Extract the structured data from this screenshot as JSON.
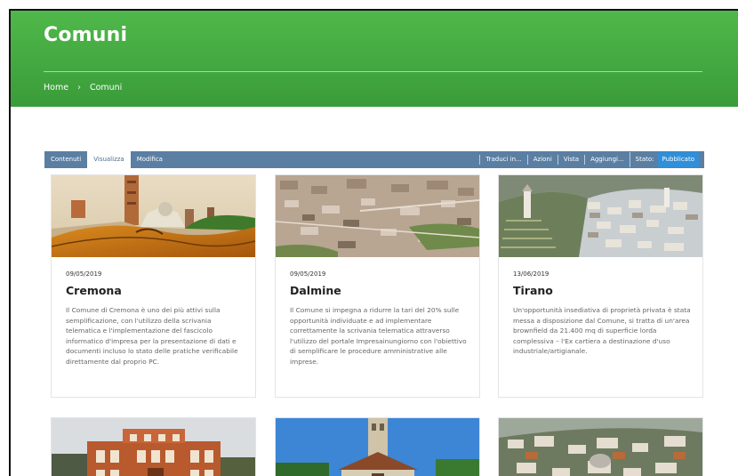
{
  "page": {
    "title": "Comuni",
    "breadcrumb": {
      "home": "Home",
      "separator": "›",
      "current": "Comuni"
    }
  },
  "toolbar": {
    "tabs": [
      "Contenuti",
      "Visualizza",
      "Modifica"
    ],
    "active_tab": "Visualizza",
    "actions": [
      "Traduci in...",
      "Azioni",
      "Vista",
      "Aggiungi..."
    ],
    "stato_label": "Stato:",
    "stato_value": "Pubblicato"
  },
  "cards": [
    {
      "date": "09/05/2019",
      "title": "Cremona",
      "description": "Il Comune di Cremona è uno dei più attivi sulla semplificazione, con l'utilizzo della scrivania telematica e l'implementazione del fascicolo informatico d'impresa per la presentazione di dati e documenti incluso lo stato delle pratiche verificabile direttamente dal proprio PC."
    },
    {
      "date": "09/05/2019",
      "title": "Dalmine",
      "description": "Il Comune si impegna a ridurre la tari del 20% sulle opportunità individuate e ad implementare correttamente la scrivania telematica attraverso l'utilizzo del portale Impresainungiorno con l'obiettivo di semplificare le procedure amministrative alle imprese."
    },
    {
      "date": "13/06/2019",
      "title": "Tirano",
      "description": "Un'opportunità insediativa di proprietà privata è stata messa a disposizione dal Comune, si tratta di un'area brownfield da 21.400 mq di superficie lorda complessiva – l'Ex cartiera a destinazione d'uso industriale/artigianale."
    }
  ],
  "colors": {
    "header_green": "#3fa83e",
    "toolbar_blue": "#5b7fa3",
    "badge_blue": "#2f8fd8"
  }
}
